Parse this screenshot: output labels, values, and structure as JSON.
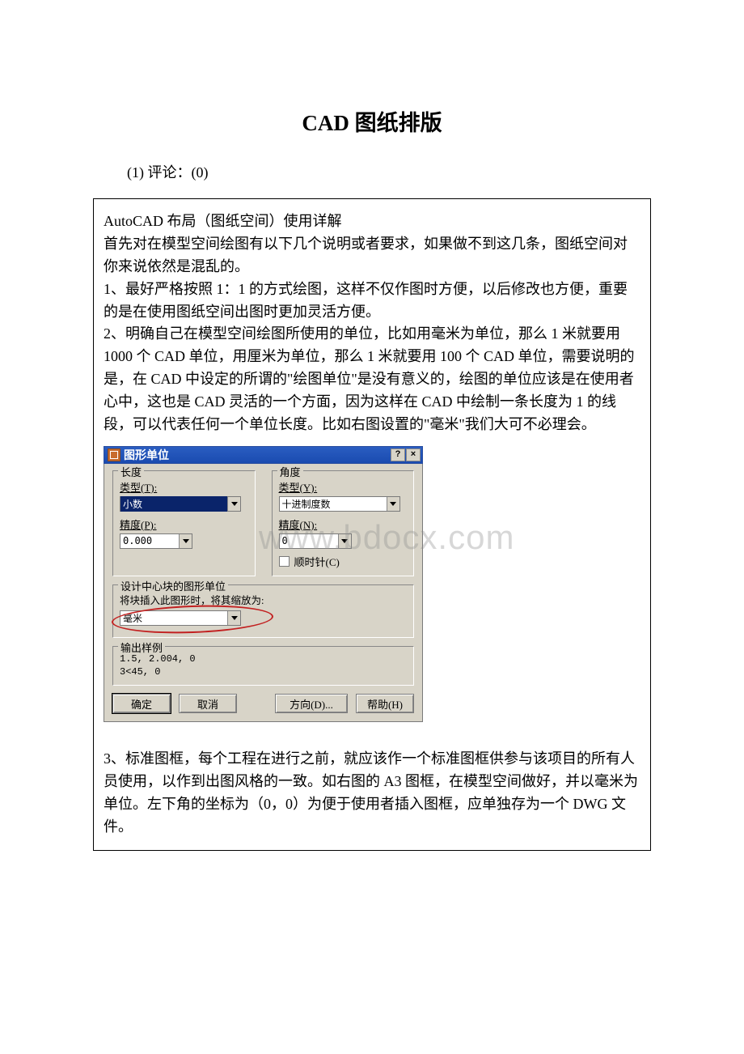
{
  "title": "CAD 图纸排版",
  "meta": "(1) 评论：(0)",
  "watermark": "www.bdocx.com",
  "body": {
    "p1": "AutoCAD 布局（图纸空间）使用详解",
    "p2": "首先对在模型空间绘图有以下几个说明或者要求，如果做不到这几条，图纸空间对你来说依然是混乱的。",
    "p3": "1、最好严格按照 1：1 的方式绘图，这样不仅作图时方便，以后修改也方便，重要的是在使用图纸空间出图时更加灵活方便。",
    "p4": "2、明确自己在模型空间绘图所使用的单位，比如用毫米为单位，那么 1 米就要用 1000 个 CAD 单位，用厘米为单位，那么 1 米就要用 100 个 CAD 单位，需要说明的是，在 CAD 中设定的所谓的\"绘图单位\"是没有意义的，绘图的单位应该是在使用者心中，这也是 CAD 灵活的一个方面，因为这样在 CAD 中绘制一条长度为 1 的线段，可以代表任何一个单位长度。比如右图设置的\"毫米\"我们大可不必理会。",
    "p5": "3、标准图框，每个工程在进行之前，就应该作一个标准图框供参与该项目的所有人员使用，以作到出图风格的一致。如右图的 A3 图框，在模型空间做好，并以毫米为单位。左下角的坐标为（0，0）为便于使用者插入图框，应单独存为一个 DWG 文件。"
  },
  "dialog": {
    "title": "图形单位",
    "help_btn": "?",
    "close_btn": "×",
    "length": {
      "group": "长度",
      "type_label": "类型(T):",
      "type_value": "小数",
      "precision_label": "精度(P):",
      "precision_value": "0.000"
    },
    "angle": {
      "group": "角度",
      "type_label": "类型(Y):",
      "type_value": "十进制度数",
      "precision_label": "精度(N):",
      "precision_value": "0",
      "clockwise": "顺时针(C)"
    },
    "insert": {
      "group": "设计中心块的图形单位",
      "hint": "将块插入此图形时，将其缩放为:",
      "value": "毫米"
    },
    "output": {
      "group": "输出样例",
      "line1": "1.5, 2.004, 0",
      "line2": "3<45, 0"
    },
    "buttons": {
      "ok": "确定",
      "cancel": "取消",
      "direction": "方向(D)...",
      "help": "帮助(H)"
    }
  }
}
